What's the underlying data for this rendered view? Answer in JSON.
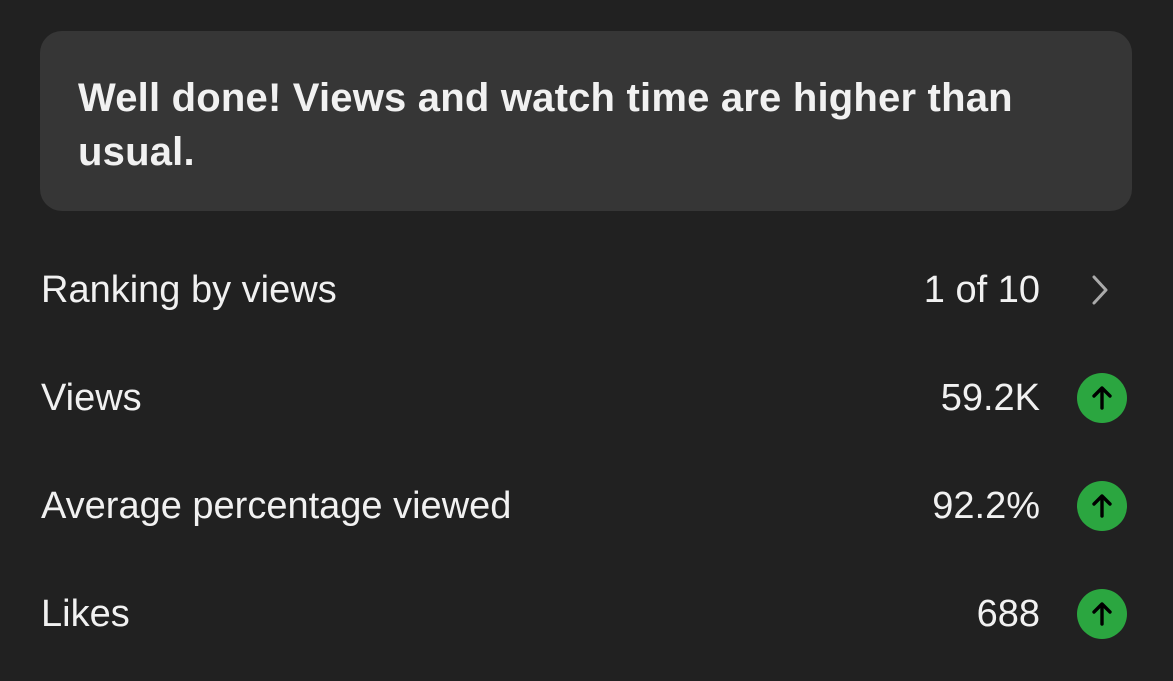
{
  "banner": {
    "message": "Well done! Views and watch time are higher than usual."
  },
  "metrics": [
    {
      "label": "Ranking by views",
      "value": "1 of 10",
      "icon": "chevron-right-icon"
    },
    {
      "label": "Views",
      "value": "59.2K",
      "icon": "arrow-up-icon"
    },
    {
      "label": "Average percentage viewed",
      "value": "92.2%",
      "icon": "arrow-up-icon"
    },
    {
      "label": "Likes",
      "value": "688",
      "icon": "arrow-up-icon"
    }
  ],
  "colors": {
    "background": "#212121",
    "banner_background": "#363636",
    "text": "#f1f1f1",
    "trend_up": "#2ba640",
    "chevron": "#aaaaaa"
  }
}
